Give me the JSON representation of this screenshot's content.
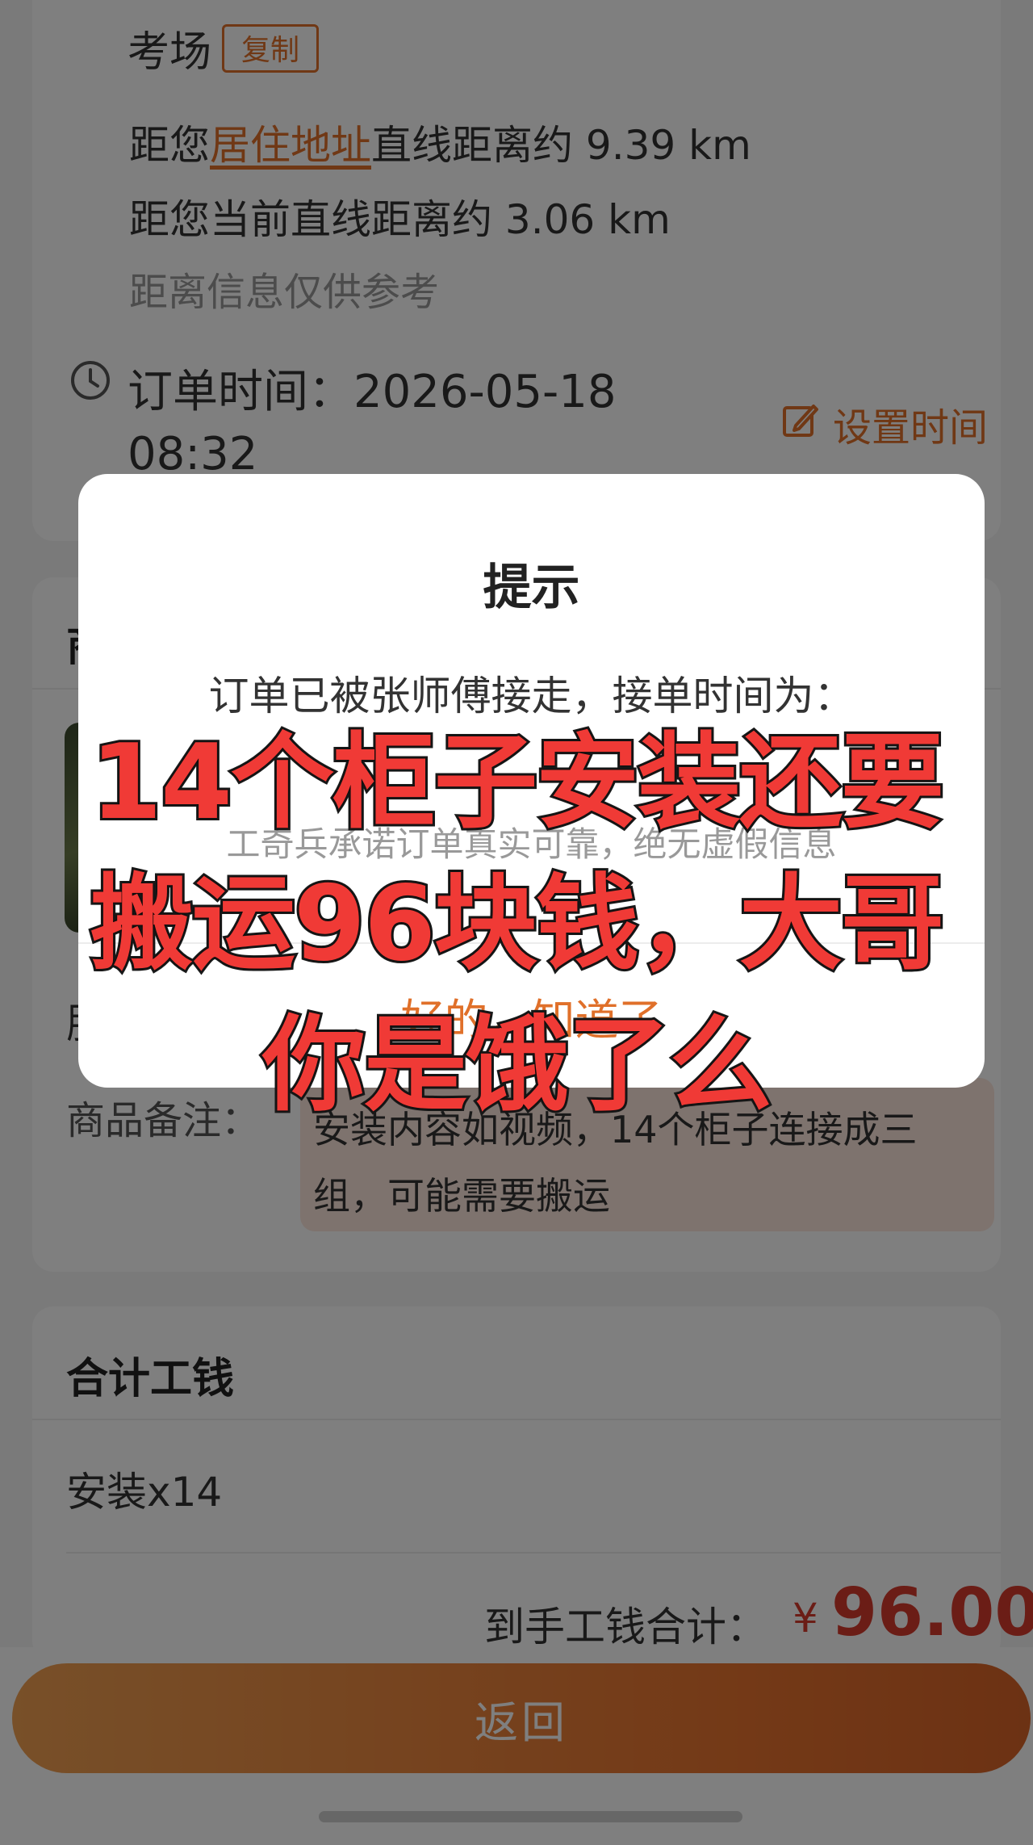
{
  "header": {
    "venue_label": "考场",
    "copy_button": "复制",
    "distance_home_prefix": "距您",
    "distance_home_link": "居住地址",
    "distance_home_suffix": "直线距离约 9.39 km",
    "distance_current": "距您当前直线距离约 3.06 km",
    "distance_note": "距离信息仅供参考",
    "order_time_label": "订单时间：2026-05-18",
    "order_time_clock": "08:32",
    "set_time_button": "设置时间"
  },
  "goods": {
    "section_title_partial": "商",
    "row_label_partial": "服",
    "remark_label": "商品备注：",
    "remark_text": "安装内容如视频，14个柜子连接成三组，可能需要搬运"
  },
  "summary": {
    "title": "合计工钱",
    "item": "安装x14",
    "total_label": "到手工钱合计：",
    "currency": "¥",
    "total_amount": "96.00"
  },
  "bottom": {
    "back_button": "返回"
  },
  "dialog": {
    "title": "提示",
    "message": "订单已被张师傅接走，接单时间为：",
    "promise": "工奇兵承诺订单真实可靠，绝无虚假信息",
    "ok_button": "好的，知道了"
  },
  "caption_overlay": {
    "line1": "14个柜子安装还要",
    "line2": "搬运96块钱，大哥",
    "line3": "你是饿了么"
  },
  "colors": {
    "accent": "#e0702a",
    "price": "#d63a2d",
    "caption": "#f03a36"
  }
}
